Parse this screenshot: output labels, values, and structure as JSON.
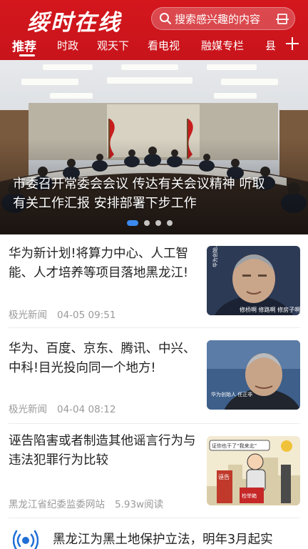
{
  "header": {
    "app_name": "绥时在线",
    "search_placeholder": "搜索感兴趣的内容"
  },
  "tabs": [
    {
      "label": "推荐",
      "active": true
    },
    {
      "label": "时政"
    },
    {
      "label": "观天下"
    },
    {
      "label": "看电视"
    },
    {
      "label": "融媒专栏"
    },
    {
      "label": "县"
    }
  ],
  "hero": {
    "caption_line1": "市委召开常委会会议 传达有关会议精神 听取",
    "caption_line2": "有关工作汇报 安排部署下步工作",
    "slide_count": 4,
    "active_slide": 1
  },
  "news": [
    {
      "title": "华为新计划!将算力中心、人工智能、人才培养等项目落地黑龙江!",
      "source": "极光新闻",
      "time": "04-05 09:51",
      "thumb_caption": "修桥啊 修路啊 修房子啊",
      "thumb_side_text": "华为创始人 任正非"
    },
    {
      "title": "华为、百度、京东、腾讯、中兴、中科!目光投向同一个地方!",
      "source": "极光新闻",
      "time": "04-04 08:12",
      "thumb_caption": "华为创始人 任正非"
    },
    {
      "title": "诬告陷害或者制造其他谣言行为与违法犯罪行为比较",
      "source": "黑龙江省纪委监委网站",
      "time": "5.93w阅读",
      "thumb_label_top": "证你也干了“我来北”",
      "thumb_label_left": "诬告",
      "thumb_label_bottom": "检举箱"
    }
  ],
  "last_item": {
    "title": "黑龙江为黑土地保护立法，明年3月起实"
  },
  "colors": {
    "brand_red": "#d4161d",
    "active_dot": "#3b8af0",
    "meta_gray": "#9a9a9a"
  }
}
